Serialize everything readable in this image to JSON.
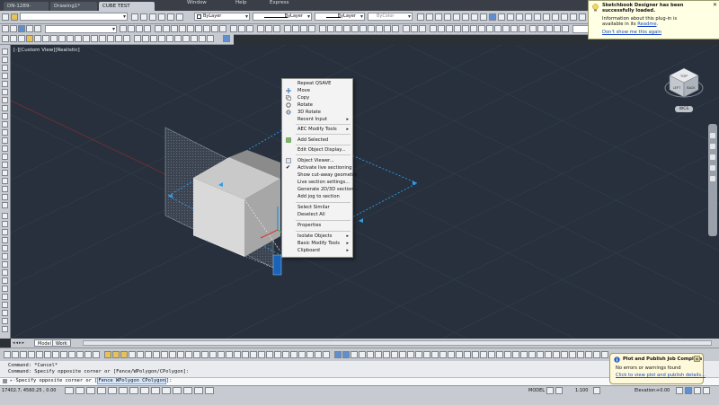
{
  "tabs": [
    {
      "label": "DN-1289-A.PSP*",
      "active": false
    },
    {
      "label": "Drawing1*",
      "active": false
    },
    {
      "label": "CUBE TEST",
      "active": true
    }
  ],
  "menu_bar": [
    "Window",
    "Help",
    "Express"
  ],
  "toolbar": {
    "layer_dropdown": "",
    "color_dropdown": "ByLayer",
    "linetype_dropdown": "ByLayer",
    "lineweight_dropdown": "ByLayer",
    "plotstyle_dropdown": "ByColor",
    "workspace_dropdown": "",
    "visual_style_dropdown": ""
  },
  "viewport": {
    "label": "[-][Custom View][Realistic]",
    "viewcube_badge": "WCS",
    "cube_faces": [
      "TOP",
      "BACK",
      "LEFT"
    ]
  },
  "context_menu": {
    "items": [
      {
        "label": "Repeat QSAVE",
        "icon": "",
        "submenu": false
      },
      {
        "label": "Move",
        "icon": "move-icon",
        "submenu": false
      },
      {
        "label": "Copy",
        "icon": "copy-icon",
        "submenu": false
      },
      {
        "label": "Rotate",
        "icon": "rotate-icon",
        "submenu": false
      },
      {
        "label": "3D Rotate",
        "icon": "rotate3d-icon",
        "submenu": false
      },
      {
        "label": "Recent Input",
        "icon": "",
        "submenu": true
      },
      {
        "label": "AEC Modify Tools",
        "icon": "",
        "submenu": true
      },
      {
        "label": "Add Selected",
        "icon": "add-selected-icon",
        "submenu": false
      },
      {
        "label": "Edit Object Display...",
        "icon": "",
        "submenu": false
      },
      {
        "label": "Object Viewer...",
        "icon": "viewer-icon",
        "submenu": false
      },
      {
        "label": "Activate live sectioning",
        "icon": "check-icon",
        "submenu": false
      },
      {
        "label": "Show cut-away geometry",
        "icon": "",
        "submenu": false
      },
      {
        "label": "Live section settings...",
        "icon": "",
        "submenu": false
      },
      {
        "label": "Generate 2D/3D section...",
        "icon": "",
        "submenu": false
      },
      {
        "label": "Add jog to section",
        "icon": "",
        "submenu": false
      },
      {
        "label": "Select Similar",
        "icon": "",
        "submenu": false
      },
      {
        "label": "Deselect All",
        "icon": "",
        "submenu": false
      },
      {
        "label": "Properties",
        "icon": "",
        "submenu": false
      },
      {
        "label": "Isolate Objects",
        "icon": "",
        "submenu": true
      },
      {
        "label": "Basic Modify Tools",
        "icon": "",
        "submenu": true
      },
      {
        "label": "Clipboard",
        "icon": "",
        "submenu": true
      }
    ]
  },
  "layout_tabs": [
    "Model",
    "Work"
  ],
  "command": {
    "history": [
      "Command: *Cancel*",
      "Command: Specify opposite corner or [Fence/WPolygon/CPolygon]:"
    ],
    "prompt": "Specify opposite corner or",
    "prompt_options": "Fence WPolygon CPolygon",
    "prompt_close": "]:"
  },
  "status": {
    "coordinates": "17402.7, 4560.25 , 0.00",
    "model_label": "MODEL",
    "scale": "1:100",
    "elevation_label": "Elevation:",
    "elevation_value": "+0.00"
  },
  "notification_plugin": {
    "title": "Sketchbook Designer has been successfully loaded.",
    "title_line1": "Sketchbook Designer has been",
    "title_line2": "successfully loaded.",
    "body_line1": "Information about this plug-in is",
    "body_line2_prefix": "available in its",
    "body_link": "Readme",
    "dismiss_link": "Don't show me this again"
  },
  "notification_plot": {
    "title": "Plot and Publish Job Complete",
    "body": "No errors or warnings found",
    "link": "Click to view plot and publish details..."
  }
}
